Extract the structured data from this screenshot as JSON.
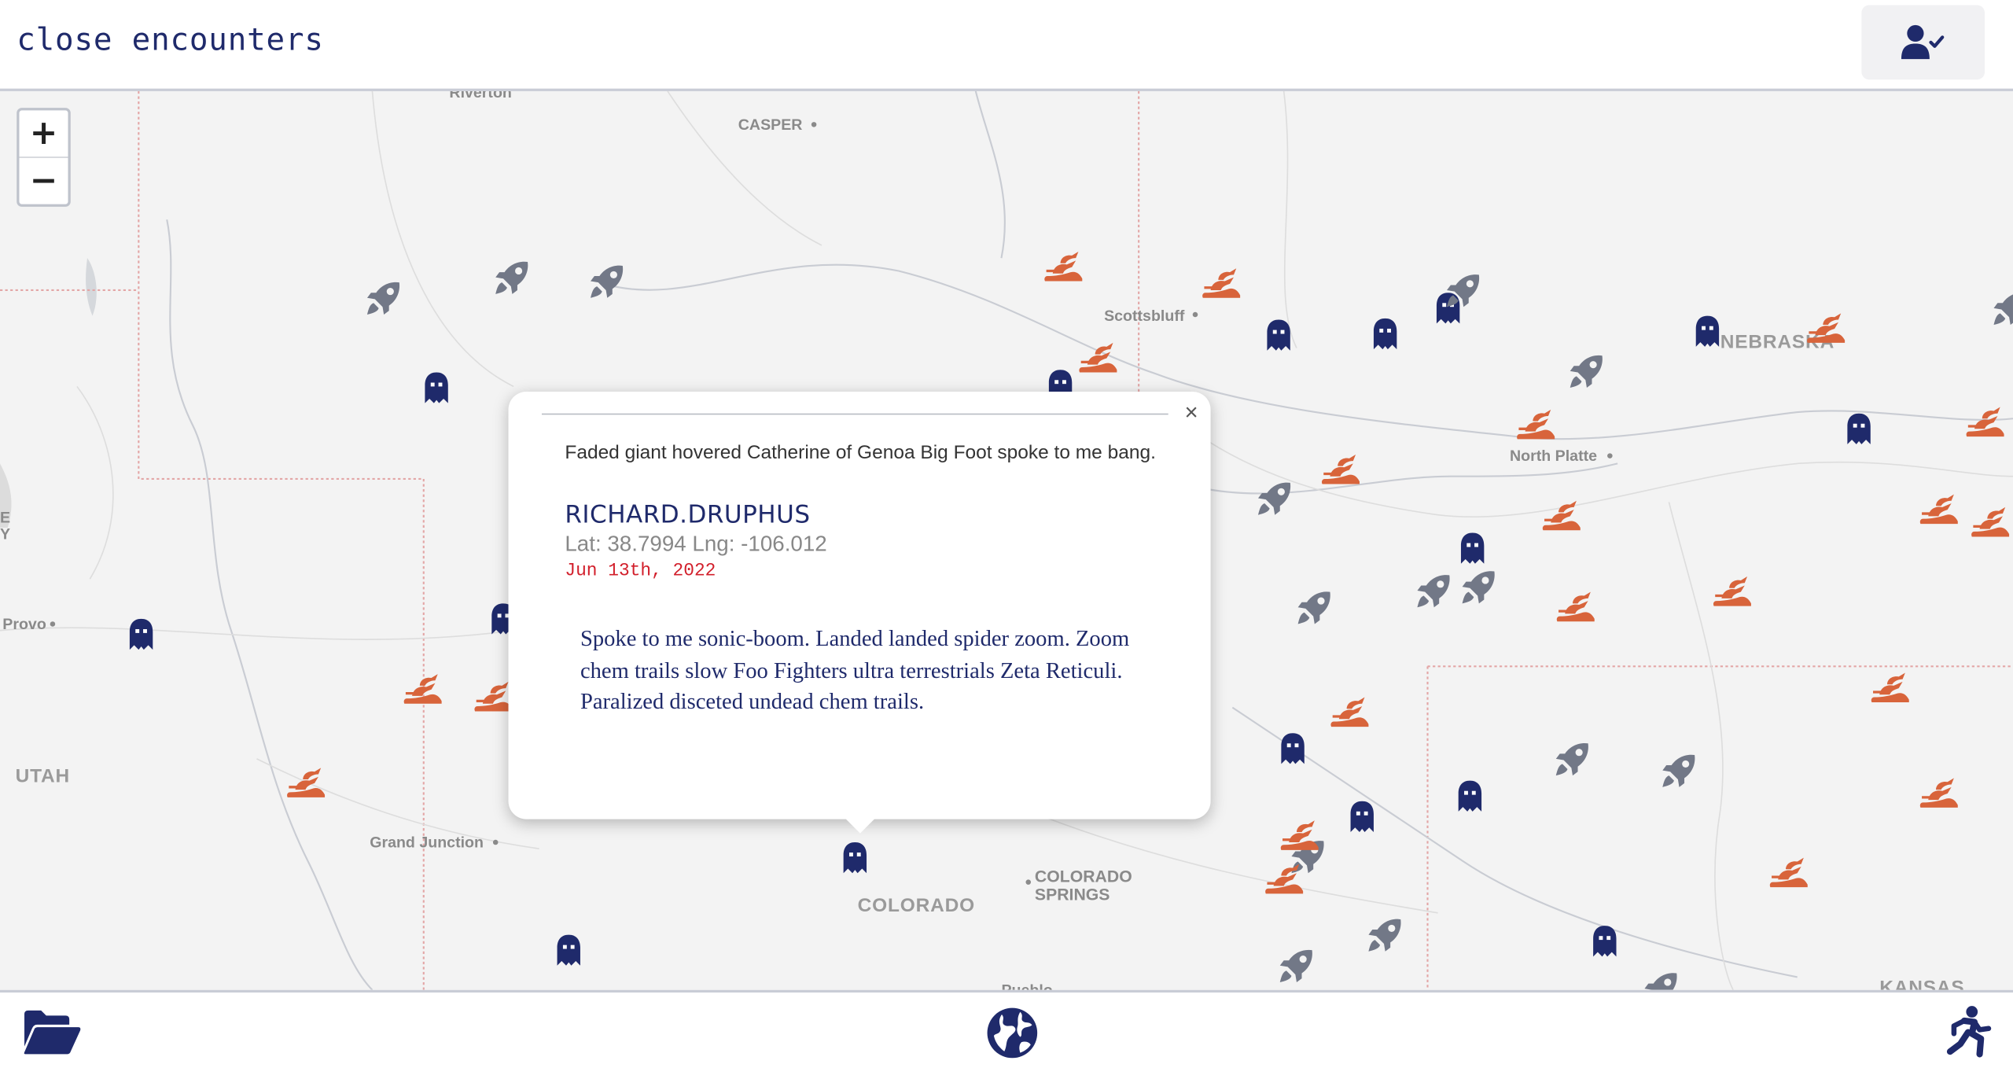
{
  "header": {
    "title": "close encounters",
    "profile_icon": "user-check-icon"
  },
  "map": {
    "zoom_in": "+",
    "zoom_out": "−",
    "places": [
      {
        "name": "Riverton",
        "type": "city"
      },
      {
        "name": "CASPER",
        "type": "city"
      },
      {
        "name": "Scottsbluff",
        "type": "city"
      },
      {
        "name": "NEBRASKA",
        "type": "state"
      },
      {
        "name": "North Platte",
        "type": "city"
      },
      {
        "name": "Provo",
        "type": "city"
      },
      {
        "name": "UTAH",
        "type": "state"
      },
      {
        "name": "Grand Junction",
        "type": "city"
      },
      {
        "name": "COLORADO",
        "type": "state"
      },
      {
        "name": "COLORADO",
        "type": "city"
      },
      {
        "name": "SPRINGS",
        "type": "city"
      },
      {
        "name": "Pueblo",
        "type": "city"
      },
      {
        "name": "KANSAS",
        "type": "state"
      },
      {
        "name": "E",
        "type": "city"
      },
      {
        "name": "Y",
        "type": "city"
      }
    ],
    "marker_types": {
      "ghost": "ghost-icon",
      "rocket": "rocket-icon",
      "bigfoot": "bigfoot-icon"
    },
    "colors": {
      "ghost": "#1f2a6b",
      "rocket": "#727887",
      "bigfoot": "#d8643b"
    }
  },
  "popup": {
    "headline": "Faded giant hovered Catherine of Genoa Big Foot spoke to me bang.",
    "username": "RICHARD.DRUPHUS",
    "coords": "Lat: 38.7994 Lng: -106.012",
    "date": "Jun 13th, 2022",
    "body": "Spoke to me sonic-boom. Landed landed spider zoom. Zoom chem trails slow Foo Fighters ultra terrestrials Zeta Reticuli. Paralized disceted undead chem trails.",
    "close_label": "×"
  },
  "footer": {
    "left_icon": "folder-open-icon",
    "center_icon": "globe-icon",
    "right_icon": "running-person-icon"
  }
}
